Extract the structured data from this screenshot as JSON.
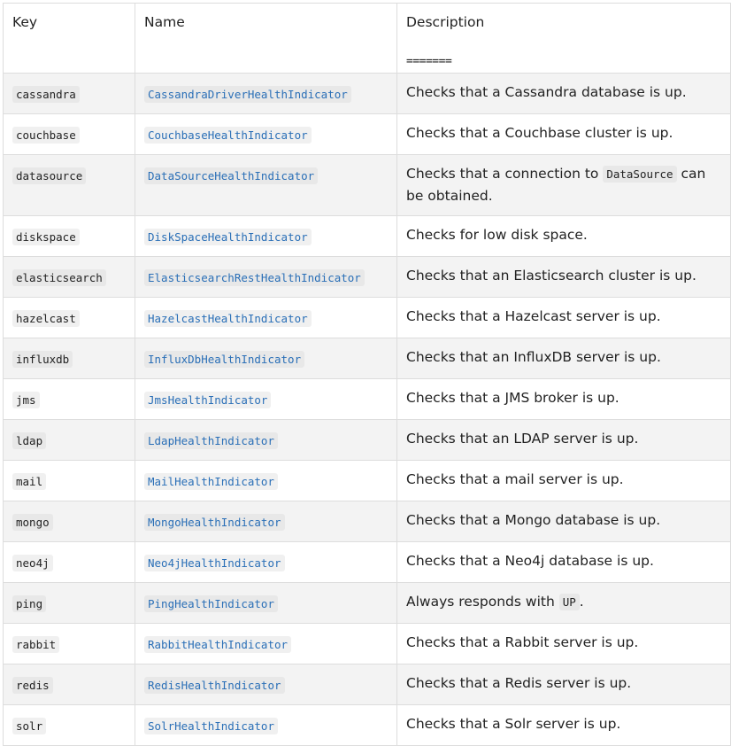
{
  "headers": {
    "key": "Key",
    "name": "Name",
    "description": "Description",
    "description_separator": "======="
  },
  "rows": [
    {
      "key": "cassandra",
      "name": "CassandraDriverHealthIndicator",
      "desc_pre": "Checks that a Cassandra database is up.",
      "desc_code": "",
      "desc_post": ""
    },
    {
      "key": "couchbase",
      "name": "CouchbaseHealthIndicator",
      "desc_pre": "Checks that a Couchbase cluster is up.",
      "desc_code": "",
      "desc_post": ""
    },
    {
      "key": "datasource",
      "name": "DataSourceHealthIndicator",
      "desc_pre": "Checks that a connection to ",
      "desc_code": "DataSource",
      "desc_post": " can be obtained."
    },
    {
      "key": "diskspace",
      "name": "DiskSpaceHealthIndicator",
      "desc_pre": "Checks for low disk space.",
      "desc_code": "",
      "desc_post": ""
    },
    {
      "key": "elasticsearch",
      "name": "ElasticsearchRestHealthIndicator",
      "desc_pre": "Checks that an Elasticsearch cluster is up.",
      "desc_code": "",
      "desc_post": ""
    },
    {
      "key": "hazelcast",
      "name": "HazelcastHealthIndicator",
      "desc_pre": "Checks that a Hazelcast server is up.",
      "desc_code": "",
      "desc_post": ""
    },
    {
      "key": "influxdb",
      "name": "InfluxDbHealthIndicator",
      "desc_pre": "Checks that an InfluxDB server is up.",
      "desc_code": "",
      "desc_post": ""
    },
    {
      "key": "jms",
      "name": "JmsHealthIndicator",
      "desc_pre": "Checks that a JMS broker is up.",
      "desc_code": "",
      "desc_post": ""
    },
    {
      "key": "ldap",
      "name": "LdapHealthIndicator",
      "desc_pre": "Checks that an LDAP server is up.",
      "desc_code": "",
      "desc_post": ""
    },
    {
      "key": "mail",
      "name": "MailHealthIndicator",
      "desc_pre": "Checks that a mail server is up.",
      "desc_code": "",
      "desc_post": ""
    },
    {
      "key": "mongo",
      "name": "MongoHealthIndicator",
      "desc_pre": "Checks that a Mongo database is up.",
      "desc_code": "",
      "desc_post": ""
    },
    {
      "key": "neo4j",
      "name": "Neo4jHealthIndicator",
      "desc_pre": "Checks that a Neo4j database is up.",
      "desc_code": "",
      "desc_post": ""
    },
    {
      "key": "ping",
      "name": "PingHealthIndicator",
      "desc_pre": "Always responds with ",
      "desc_code": "UP",
      "desc_post": "."
    },
    {
      "key": "rabbit",
      "name": "RabbitHealthIndicator",
      "desc_pre": "Checks that a Rabbit server is up.",
      "desc_code": "",
      "desc_post": ""
    },
    {
      "key": "redis",
      "name": "RedisHealthIndicator",
      "desc_pre": "Checks that a Redis server is up.",
      "desc_code": "",
      "desc_post": ""
    },
    {
      "key": "solr",
      "name": "SolrHealthIndicator",
      "desc_pre": "Checks that a Solr server is up.",
      "desc_code": "",
      "desc_post": ""
    }
  ]
}
